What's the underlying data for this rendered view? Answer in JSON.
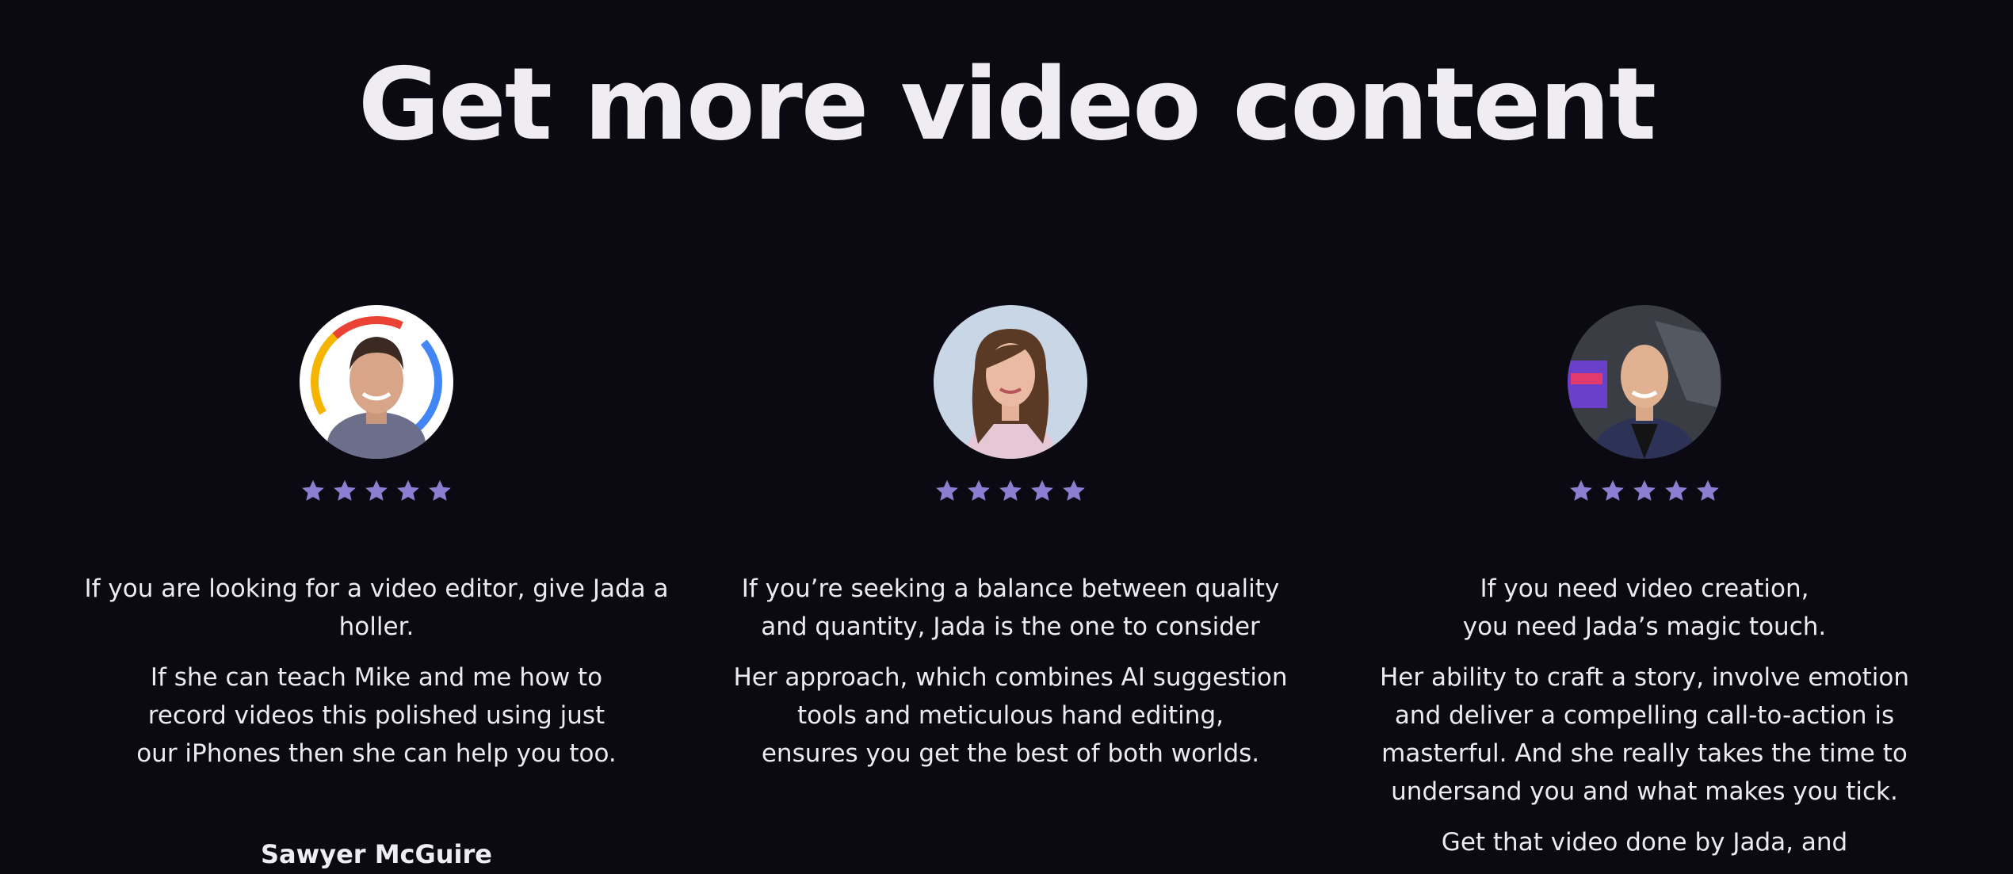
{
  "section": {
    "title": "Get more video content"
  },
  "colors": {
    "background": "#0b0912",
    "star": "#8c7fd1",
    "text": "#ecebf1"
  },
  "testimonials": [
    {
      "avatar_icon": "person-avatar-icon",
      "rating": 5,
      "paragraphs": [
        "If you are looking for a video editor, give Jada a holler.",
        "If she can teach Mike and me how to\nrecord videos this polished using just\nour iPhones then she can help you too."
      ],
      "author": "Sawyer McGuire"
    },
    {
      "avatar_icon": "person-avatar-icon",
      "rating": 5,
      "paragraphs": [
        "If you’re seeking a balance between quality\nand quantity, Jada is the one to consider",
        "Her approach, which combines AI suggestion\ntools and meticulous hand editing,\nensures you get the best of both worlds."
      ]
    },
    {
      "avatar_icon": "person-avatar-icon",
      "rating": 5,
      "paragraphs": [
        "If you need video creation,\nyou need Jada’s magic touch.",
        "Her ability to craft a story, involve emotion\nand deliver a compelling call-to-action is\nmasterful. And she really takes the time to\nundersand you and what makes you tick.",
        "Get that video done by Jada, and"
      ]
    }
  ]
}
